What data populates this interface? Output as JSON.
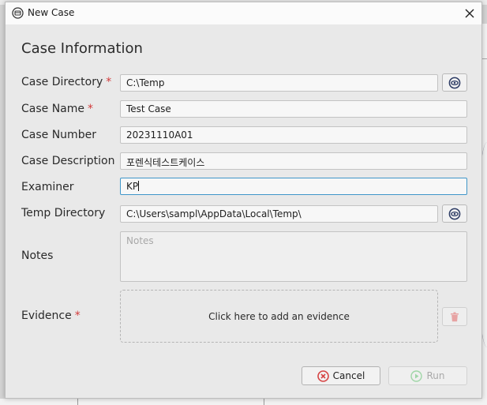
{
  "window": {
    "title": "New Case",
    "close_glyph": "✕"
  },
  "form": {
    "section_title": "Case Information",
    "required_marker": "*",
    "case_directory": {
      "label": "Case Directory",
      "value": "C:\\Temp"
    },
    "case_name": {
      "label": "Case Name",
      "value": "Test Case"
    },
    "case_number": {
      "label": "Case Number",
      "value": "20231110A01"
    },
    "case_description": {
      "label": "Case Description",
      "value": "포렌식테스트케이스"
    },
    "examiner": {
      "label": "Examiner",
      "value": "KP"
    },
    "temp_directory": {
      "label": "Temp Directory",
      "value": "C:\\Users\\sampl\\AppData\\Local\\Temp\\"
    },
    "notes": {
      "label": "Notes",
      "placeholder": "Notes",
      "value": ""
    },
    "evidence": {
      "label": "Evidence",
      "drop_text": "Click here to add an evidence"
    }
  },
  "buttons": {
    "cancel": "Cancel",
    "run": "Run",
    "run_enabled": false
  },
  "icons": {
    "app": "case-app-icon",
    "browse": "eye-icon",
    "delete": "trash-icon",
    "cancel": "cancel-x-icon",
    "run": "play-icon"
  },
  "colors": {
    "required": "#d23a3a",
    "focus_border": "#3f96c9",
    "browse_icon": "#2b3a63",
    "cancel_icon": "#d64545",
    "trash_icon": "#e7a3a3"
  }
}
